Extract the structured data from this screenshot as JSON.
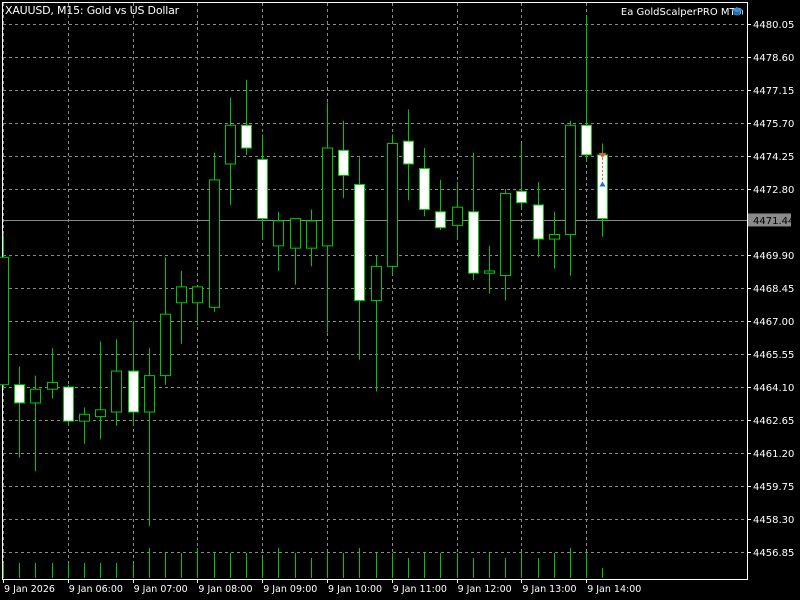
{
  "window": {
    "title": "XAUUSD, M15:  Gold vs US Dollar",
    "ea_name": "Ea GoldScalperPRO MT5"
  },
  "colors": {
    "background": "#000000",
    "foreground": "#ffffff",
    "grid": "#8a8a8a",
    "bull_body": "#000000",
    "bear_body": "#ffffff",
    "wick": "#00c800",
    "volume": "#00c800",
    "price_line": "#8a8a8a",
    "price_label_bg": "#8a8a8a",
    "sell_arrow": "#e05a3a",
    "buy_arrow": "#1e6fd8"
  },
  "current_price": "4471.44",
  "price_axis": {
    "labels": [
      "4480.05",
      "4478.60",
      "4477.15",
      "4475.70",
      "4474.25",
      "4472.80",
      "4471.44",
      "4469.90",
      "4468.45",
      "4467.00",
      "4465.55",
      "4464.10",
      "4462.65",
      "4461.20",
      "4459.75",
      "4458.30",
      "4456.85"
    ]
  },
  "time_axis": {
    "labels": [
      "9 Jan 2026",
      "9 Jan 06:00",
      "9 Jan 07:00",
      "9 Jan 08:00",
      "9 Jan 09:00",
      "9 Jan 10:00",
      "9 Jan 11:00",
      "9 Jan 12:00",
      "9 Jan 13:00",
      "9 Jan 14:00"
    ]
  },
  "chart_data": {
    "type": "candlestick",
    "symbol": "XAUUSD",
    "timeframe": "M15",
    "title": "XAUUSD, M15:  Gold vs US Dollar",
    "ylim": [
      4456.0,
      4480.6
    ],
    "candles": [
      {
        "o": 4464.2,
        "h": 4470.8,
        "l": 4464.0,
        "c": 4469.8
      },
      {
        "o": 4464.2,
        "h": 4465.0,
        "l": 4461.0,
        "c": 4463.4
      },
      {
        "o": 4463.4,
        "h": 4464.6,
        "l": 4460.4,
        "c": 4464.0
      },
      {
        "o": 4464.0,
        "h": 4465.8,
        "l": 4463.6,
        "c": 4464.3
      },
      {
        "o": 4464.1,
        "h": 4464.2,
        "l": 4462.4,
        "c": 4462.6
      },
      {
        "o": 4462.6,
        "h": 4463.2,
        "l": 4461.6,
        "c": 4462.9
      },
      {
        "o": 4462.8,
        "h": 4466.1,
        "l": 4461.8,
        "c": 4463.1
      },
      {
        "o": 4463.0,
        "h": 4466.2,
        "l": 4462.4,
        "c": 4464.8
      },
      {
        "o": 4464.8,
        "h": 4467.0,
        "l": 4462.4,
        "c": 4463.0
      },
      {
        "o": 4463.0,
        "h": 4465.8,
        "l": 4458.0,
        "c": 4464.6
      },
      {
        "o": 4464.6,
        "h": 4469.8,
        "l": 4464.2,
        "c": 4467.3
      },
      {
        "o": 4467.8,
        "h": 4469.2,
        "l": 4466.0,
        "c": 4468.5
      },
      {
        "o": 4467.8,
        "h": 4468.5,
        "l": 4466.8,
        "c": 4468.5
      },
      {
        "o": 4467.6,
        "h": 4474.4,
        "l": 4467.4,
        "c": 4473.2
      },
      {
        "o": 4473.9,
        "h": 4476.8,
        "l": 4472.1,
        "c": 4475.6
      },
      {
        "o": 4475.6,
        "h": 4477.6,
        "l": 4474.3,
        "c": 4474.6
      },
      {
        "o": 4474.1,
        "h": 4475.2,
        "l": 4470.6,
        "c": 4471.5
      },
      {
        "o": 4470.3,
        "h": 4471.8,
        "l": 4469.2,
        "c": 4471.4
      },
      {
        "o": 4470.2,
        "h": 4471.5,
        "l": 4468.6,
        "c": 4471.5
      },
      {
        "o": 4470.2,
        "h": 4471.9,
        "l": 4469.4,
        "c": 4471.4
      },
      {
        "o": 4470.3,
        "h": 4476.6,
        "l": 4466.5,
        "c": 4474.6
      },
      {
        "o": 4474.5,
        "h": 4475.8,
        "l": 4472.4,
        "c": 4473.4
      },
      {
        "o": 4473.0,
        "h": 4474.2,
        "l": 4465.3,
        "c": 4467.9
      },
      {
        "o": 4467.9,
        "h": 4469.9,
        "l": 4463.9,
        "c": 4469.4
      },
      {
        "o": 4469.4,
        "h": 4475.2,
        "l": 4469.0,
        "c": 4474.8
      },
      {
        "o": 4474.9,
        "h": 4476.3,
        "l": 4472.3,
        "c": 4473.9
      },
      {
        "o": 4473.7,
        "h": 4474.6,
        "l": 4471.6,
        "c": 4471.9
      },
      {
        "o": 4471.8,
        "h": 4473.2,
        "l": 4471.0,
        "c": 4471.1
      },
      {
        "o": 4471.2,
        "h": 4473.1,
        "l": 4470.6,
        "c": 4472.0
      },
      {
        "o": 4471.8,
        "h": 4474.4,
        "l": 4468.8,
        "c": 4469.1
      },
      {
        "o": 4469.1,
        "h": 4470.3,
        "l": 4468.2,
        "c": 4469.2
      },
      {
        "o": 4469.0,
        "h": 4472.8,
        "l": 4467.9,
        "c": 4472.6
      },
      {
        "o": 4472.7,
        "h": 4474.8,
        "l": 4472.0,
        "c": 4472.2
      },
      {
        "o": 4472.1,
        "h": 4473.1,
        "l": 4469.8,
        "c": 4470.6
      },
      {
        "o": 4470.6,
        "h": 4471.8,
        "l": 4469.3,
        "c": 4470.8
      },
      {
        "o": 4470.8,
        "h": 4475.8,
        "l": 4469.0,
        "c": 4475.6
      },
      {
        "o": 4475.6,
        "h": 4480.4,
        "l": 4474.0,
        "c": 4474.3
      },
      {
        "o": 4474.3,
        "h": 4474.8,
        "l": 4470.7,
        "c": 4471.5
      }
    ],
    "volumes": [
      3,
      3,
      3,
      3,
      3,
      3,
      3,
      3,
      3,
      6,
      5,
      5,
      6,
      5,
      5,
      5,
      4,
      6,
      5,
      4,
      5,
      5,
      6,
      5,
      5,
      4,
      5,
      5,
      5,
      4,
      5,
      4,
      5,
      4,
      5,
      6,
      5,
      2
    ],
    "markers": [
      {
        "type": "sell",
        "price": 4474.3
      },
      {
        "type": "buy",
        "price": 4473.0
      }
    ]
  }
}
